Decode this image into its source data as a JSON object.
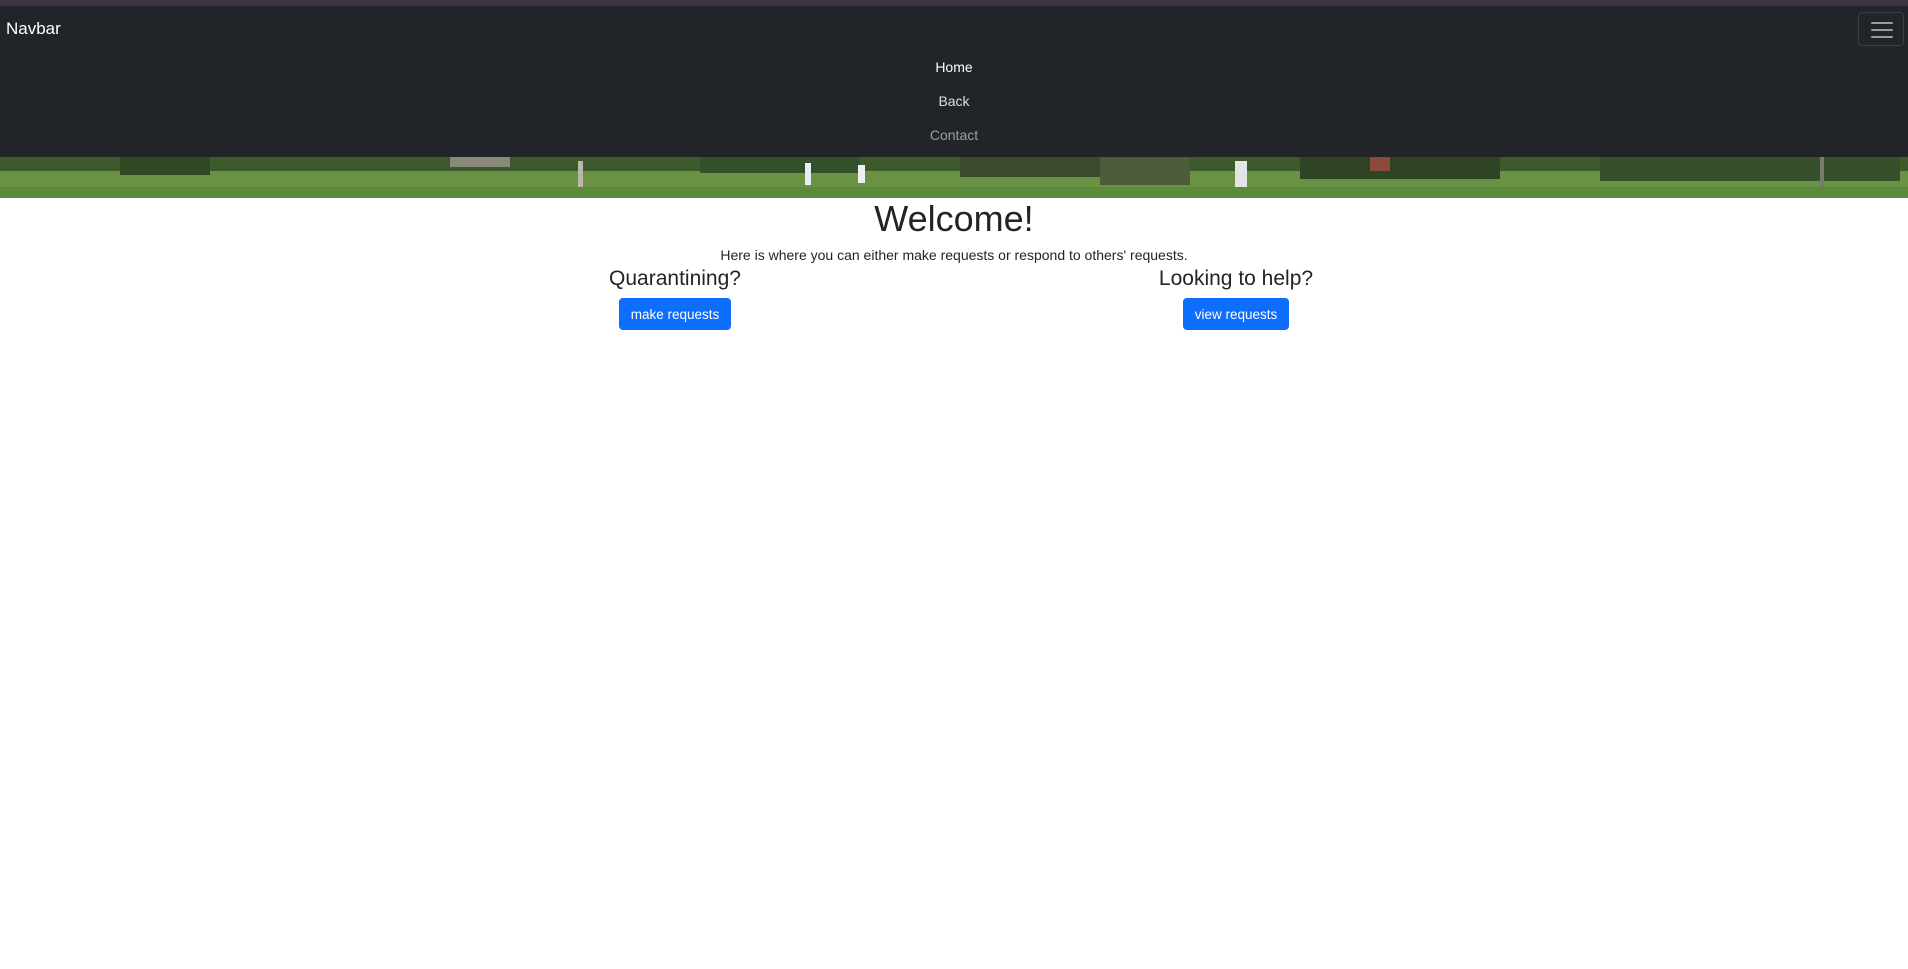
{
  "navbar": {
    "brand": "Navbar",
    "toggler_icon": "hamburger-menu-icon",
    "links": [
      {
        "label": "Home"
      },
      {
        "label": "Back"
      },
      {
        "label": "Contact"
      }
    ]
  },
  "main": {
    "title": "Welcome!",
    "subtitle": "Here is where you can either make requests or respond to others' requests.",
    "left": {
      "heading": "Quarantining?",
      "button": "make requests"
    },
    "right": {
      "heading": "Looking to help?",
      "button": "view requests"
    }
  },
  "colors": {
    "navbar_bg": "#212529",
    "primary_button": "#0d6efd",
    "page_bg": "#ffffff"
  }
}
